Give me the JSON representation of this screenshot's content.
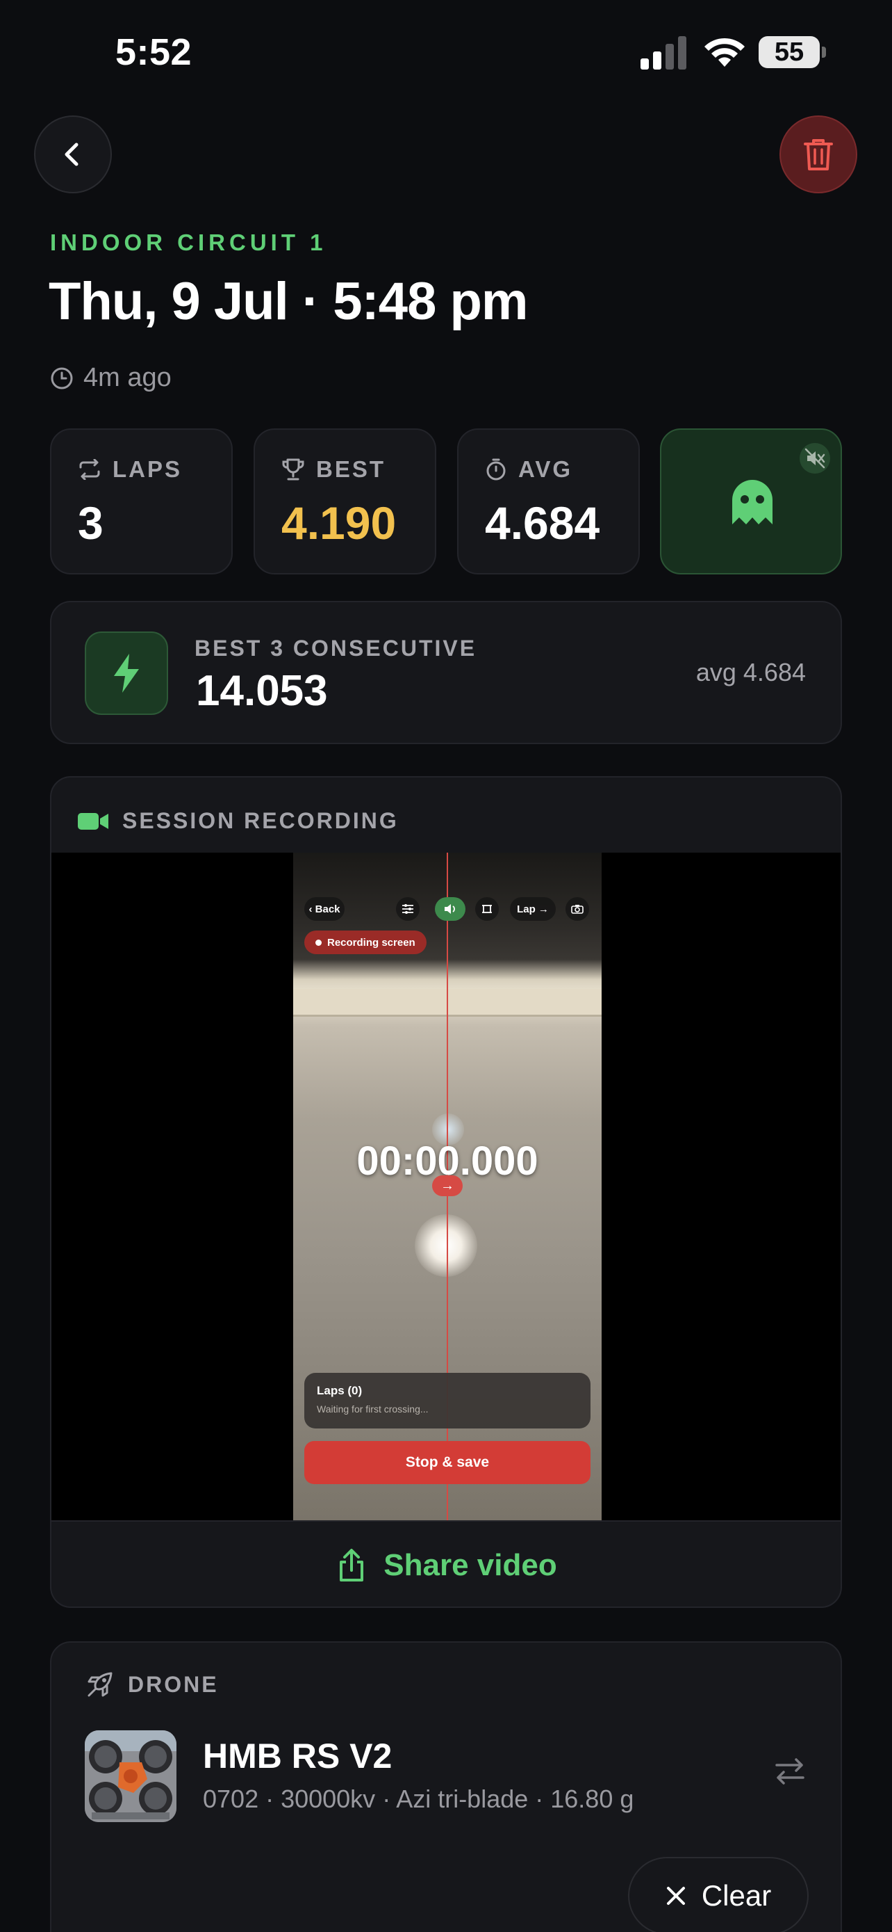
{
  "status_bar": {
    "time": "5:52",
    "battery": "55"
  },
  "header": {
    "circuit": "INDOOR CIRCUIT 1",
    "title": "Thu, 9 Jul · 5:48 pm",
    "ago": "4m ago"
  },
  "stats": {
    "laps": {
      "label": "LAPS",
      "value": "3"
    },
    "best": {
      "label": "BEST",
      "value": "4.190"
    },
    "avg": {
      "label": "AVG",
      "value": "4.684"
    }
  },
  "consecutive": {
    "label": "BEST 3 CONSECUTIVE",
    "value": "14.053",
    "avg": "avg 4.684"
  },
  "recording": {
    "header": "SESSION RECORDING",
    "video": {
      "back": "‹ Back",
      "lap": "Lap →",
      "recording_pill": "Recording screen",
      "timer": "00:00.000",
      "laps_title": "Laps (0)",
      "laps_sub": "Waiting for first crossing...",
      "stop": "Stop & save"
    },
    "share_label": "Share video"
  },
  "drone": {
    "header": "DRONE",
    "name": "HMB RS V2",
    "spec": "0702 · 30000kv · Azi tri-blade · 16.80 g"
  },
  "clear_label": "Clear",
  "colors": {
    "accent_green": "#5fcf76",
    "best_yellow": "#f2c14e",
    "danger_red": "#e0504a",
    "background": "#0c0d10",
    "card": "#16171b"
  }
}
